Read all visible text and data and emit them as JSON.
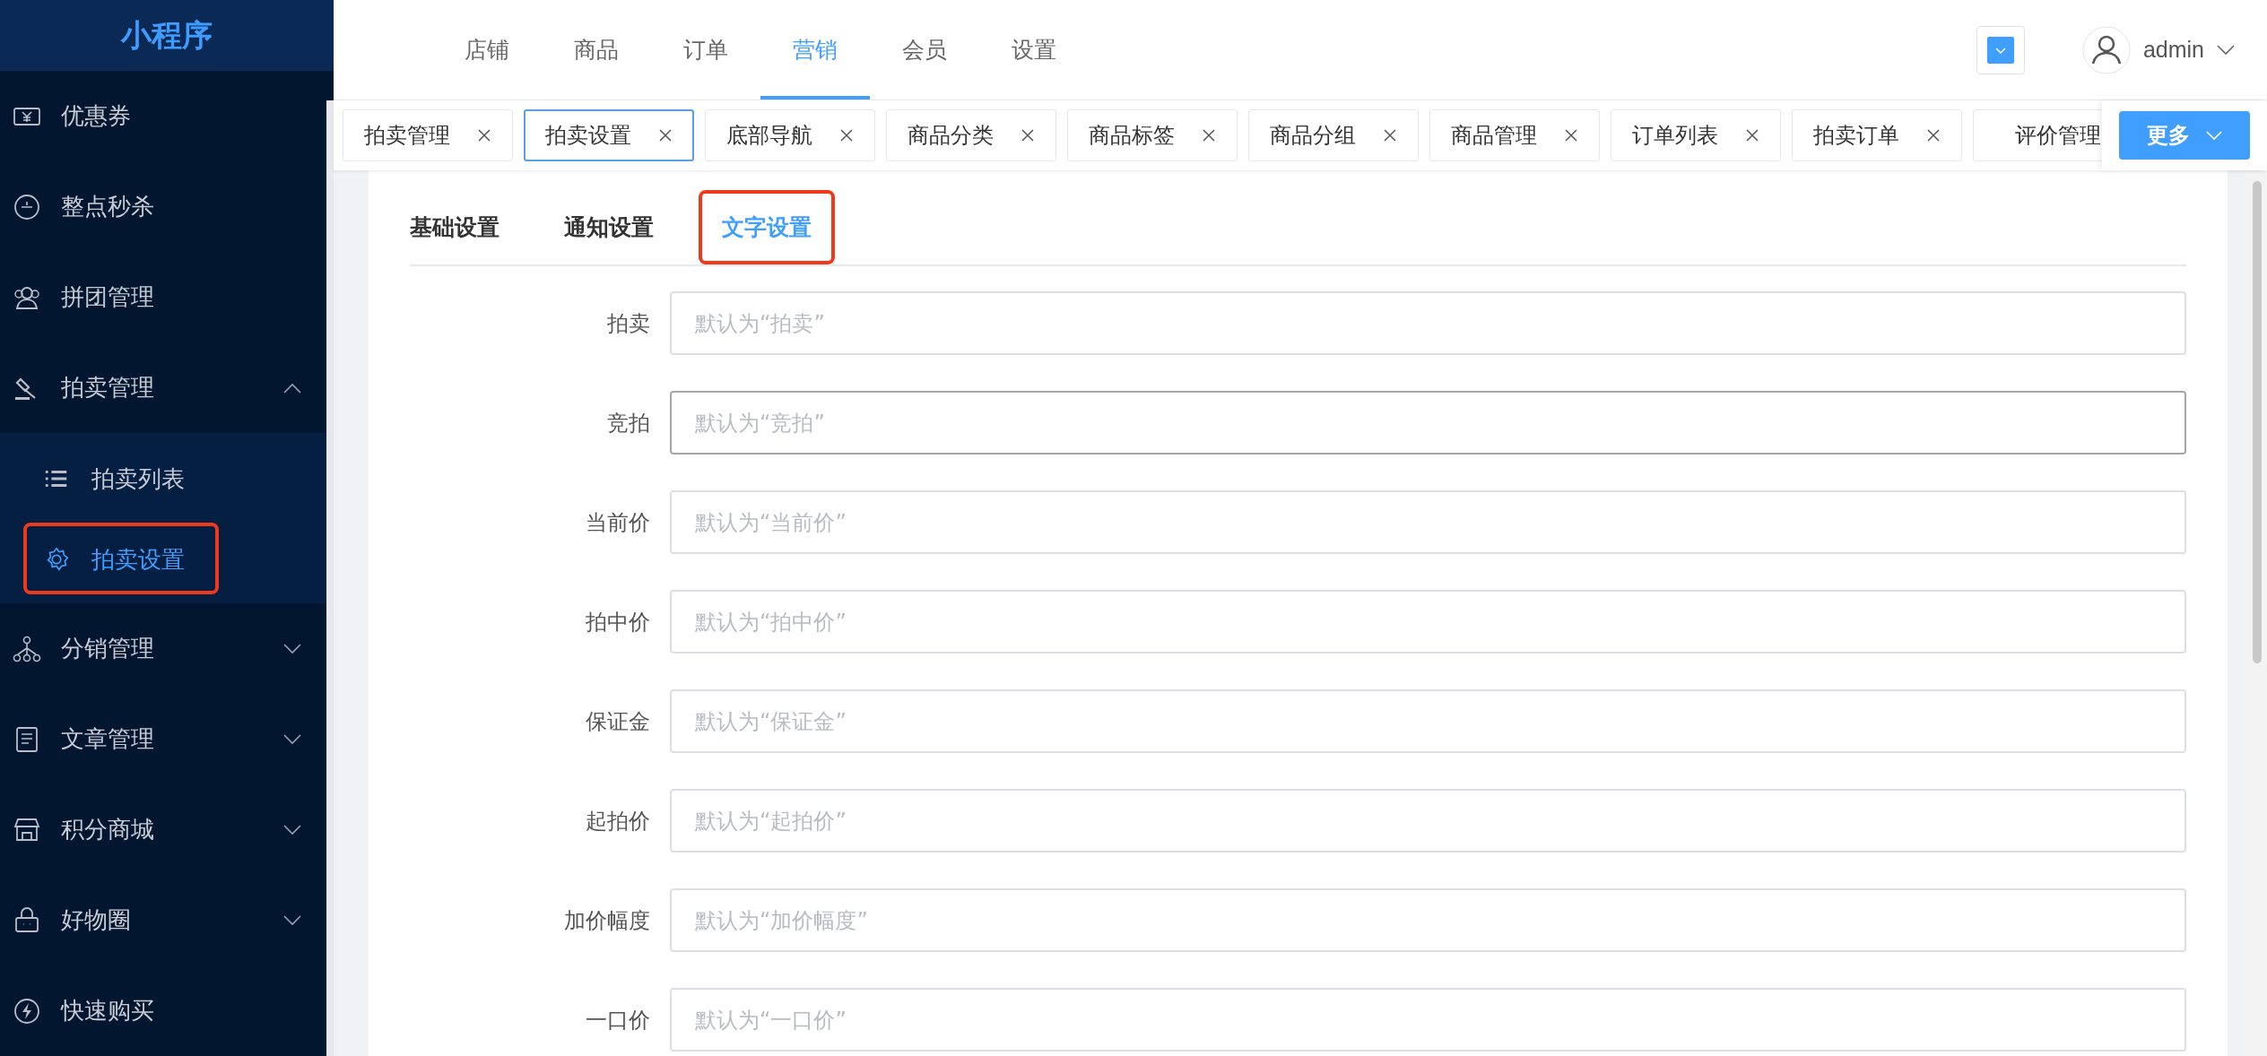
{
  "sidebar": {
    "logo": "小程序",
    "items": [
      {
        "label": "优惠券"
      },
      {
        "label": "整点秒杀"
      },
      {
        "label": "拼团管理"
      },
      {
        "label": "拍卖管理",
        "expanded": true,
        "children": [
          {
            "label": "拍卖列表",
            "selected": false,
            "highlighted": false
          },
          {
            "label": "拍卖设置",
            "selected": true,
            "highlighted": true
          }
        ]
      },
      {
        "label": "分销管理",
        "expanded": false
      },
      {
        "label": "文章管理",
        "expanded": false
      },
      {
        "label": "积分商城",
        "expanded": false
      },
      {
        "label": "好物圈",
        "expanded": false
      },
      {
        "label": "快速购买"
      }
    ]
  },
  "top_nav": [
    {
      "label": "店铺",
      "selected": false
    },
    {
      "label": "商品",
      "selected": false
    },
    {
      "label": "订单",
      "selected": false
    },
    {
      "label": "营销",
      "selected": true
    },
    {
      "label": "会员",
      "selected": false
    },
    {
      "label": "设置",
      "selected": false
    }
  ],
  "user": {
    "name": "admin"
  },
  "open_tabs": [
    {
      "label": "拍卖管理",
      "selected": false,
      "closable": true
    },
    {
      "label": "拍卖设置",
      "selected": true,
      "closable": true
    },
    {
      "label": "底部导航",
      "selected": false,
      "closable": true
    },
    {
      "label": "商品分类",
      "selected": false,
      "closable": true
    },
    {
      "label": "商品标签",
      "selected": false,
      "closable": true
    },
    {
      "label": "商品分组",
      "selected": false,
      "closable": true
    },
    {
      "label": "商品管理",
      "selected": false,
      "closable": true
    },
    {
      "label": "订单列表",
      "selected": false,
      "closable": true
    },
    {
      "label": "拍卖订单",
      "selected": false,
      "closable": true
    },
    {
      "label": "评价管理",
      "selected": false,
      "closable": false
    }
  ],
  "more_button": "更多",
  "settings_tabs": [
    {
      "label": "基础设置",
      "selected": false,
      "highlighted": false
    },
    {
      "label": "通知设置",
      "selected": false,
      "highlighted": false
    },
    {
      "label": "文字设置",
      "selected": true,
      "highlighted": true
    }
  ],
  "form": [
    {
      "label": "拍卖",
      "placeholder": "默认为“拍卖”",
      "hovered": false
    },
    {
      "label": "竞拍",
      "placeholder": "默认为“竞拍”",
      "hovered": true
    },
    {
      "label": "当前价",
      "placeholder": "默认为“当前价”",
      "hovered": false
    },
    {
      "label": "拍中价",
      "placeholder": "默认为“拍中价”",
      "hovered": false
    },
    {
      "label": "保证金",
      "placeholder": "默认为“保证金”",
      "hovered": false
    },
    {
      "label": "起拍价",
      "placeholder": "默认为“起拍价”",
      "hovered": false
    },
    {
      "label": "加价幅度",
      "placeholder": "默认为“加价幅度”",
      "hovered": false
    },
    {
      "label": "一口价",
      "placeholder": "默认为“一口价”",
      "hovered": false
    }
  ]
}
